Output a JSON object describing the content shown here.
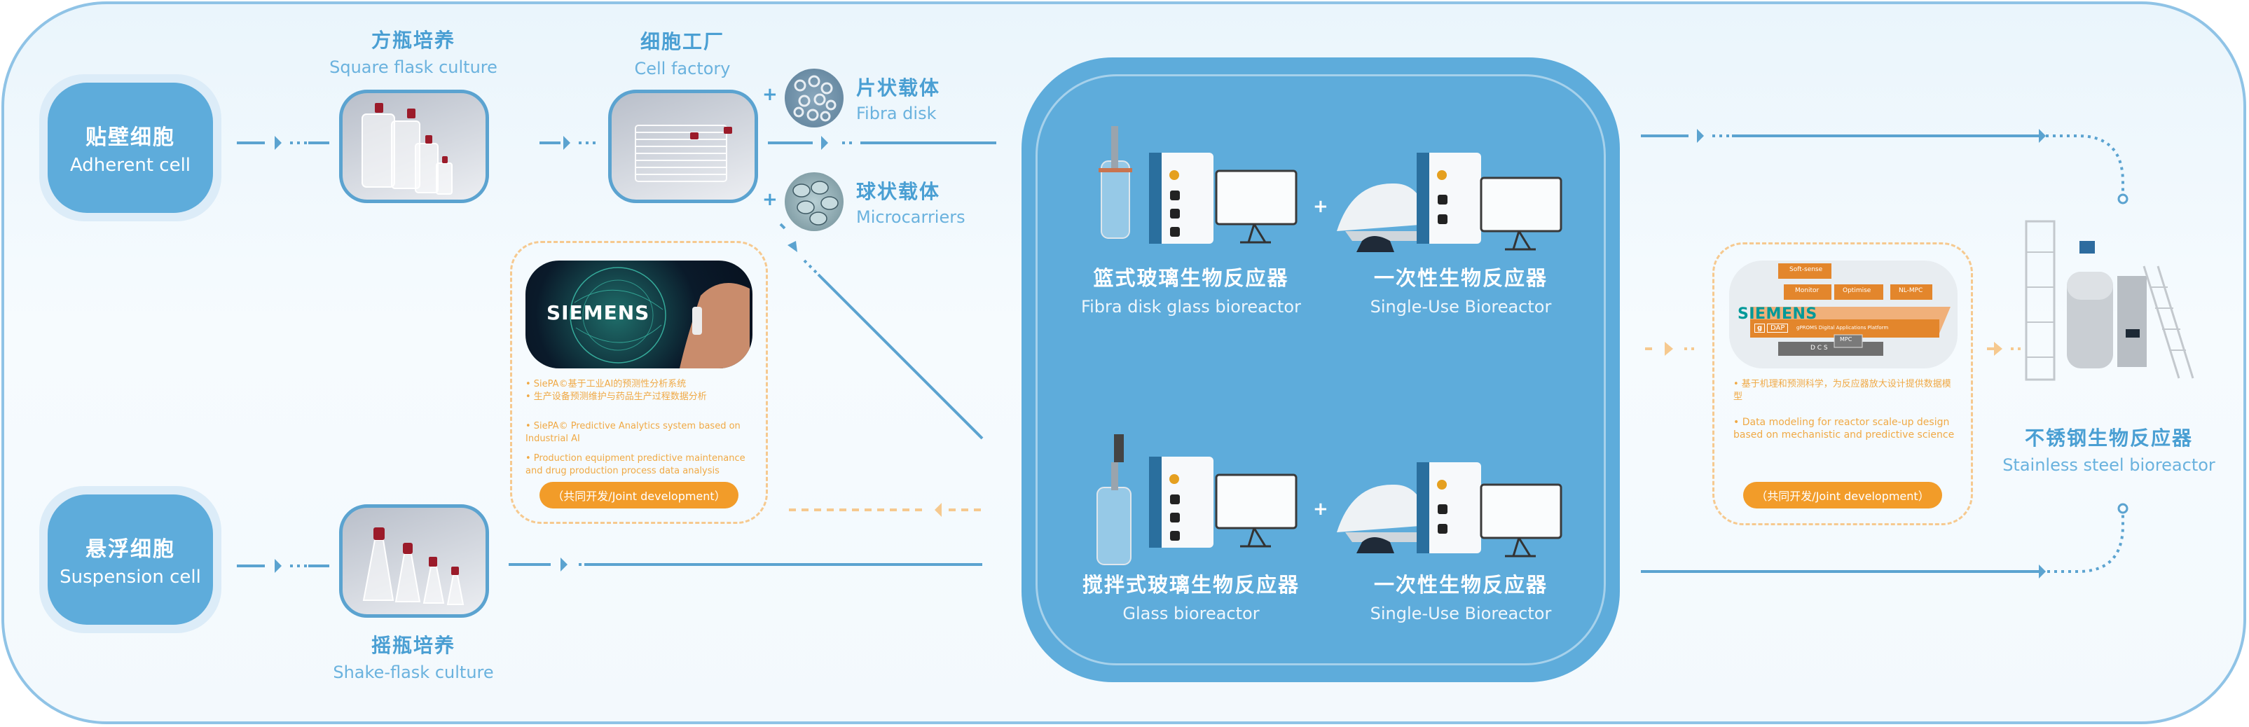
{
  "colors": {
    "primary_blue": "#5eacdb",
    "title_blue": "#4a9fd3",
    "accent_orange": "#f29c29",
    "dashed_orange": "#f6c98f",
    "siemens_teal": "#009999"
  },
  "sources": {
    "adherent": {
      "zh": "贴壁细胞",
      "en": "Adherent cell"
    },
    "suspension": {
      "zh": "悬浮细胞",
      "en": "Suspension cell"
    }
  },
  "stages": {
    "square_flask": {
      "zh": "方瓶培养",
      "en": "Square flask culture"
    },
    "cell_factory": {
      "zh": "细胞工厂",
      "en": "Cell factory"
    },
    "shake_flask": {
      "zh": "摇瓶培养",
      "en": "Shake-flask culture"
    }
  },
  "carriers": [
    {
      "zh": "片状载体",
      "en": "Fibra disk",
      "plus": "+"
    },
    {
      "zh": "球状载体",
      "en": "Microcarriers",
      "plus": "+"
    }
  ],
  "center_panel": {
    "top_left": {
      "zh": "篮式玻璃生物反应器",
      "en": "Fibra disk glass bioreactor"
    },
    "top_right": {
      "zh": "一次性生物反应器",
      "en": "Single-Use Bioreactor"
    },
    "bottom_left": {
      "zh": "搅拌式玻璃生物反应器",
      "en": "Glass bioreactor"
    },
    "bottom_right": {
      "zh": "一次性生物反应器",
      "en": "Single-Use Bioreactor"
    },
    "plus": "+"
  },
  "siepa_card": {
    "logo": "SIEMENS",
    "notes_zh": [
      "• SiePA©基于工业AI的预测性分析系统",
      "• 生产设备预测维护与药品生产过程数据分析"
    ],
    "notes_en": [
      "• SiePA© Predictive Analytics system based on Industrial AI",
      "• Production equipment predictive maintenance and drug production process data analysis"
    ],
    "button": "（共同开发/Joint development）"
  },
  "gproms_card": {
    "logo": "SIEMENS",
    "diagram": {
      "boxes": [
        "Soft-sense",
        "Monitor",
        "Optimise",
        "NL-MPC"
      ],
      "platform_badge_g": "g",
      "platform_badge": "DAP",
      "platform": "gPROMS Digital Applications Platform",
      "dcs": "D C S",
      "mpc": "MPC"
    },
    "note_zh": "• 基于机理和预测科学，为反应器放大设计提供数据模型",
    "note_en": "• Data modeling for reactor scale-up design based on mechanistic and predictive science",
    "button": "（共同开发/Joint development）"
  },
  "final": {
    "zh": "不锈钢生物反应器",
    "en": "Stainless steel bioreactor"
  }
}
